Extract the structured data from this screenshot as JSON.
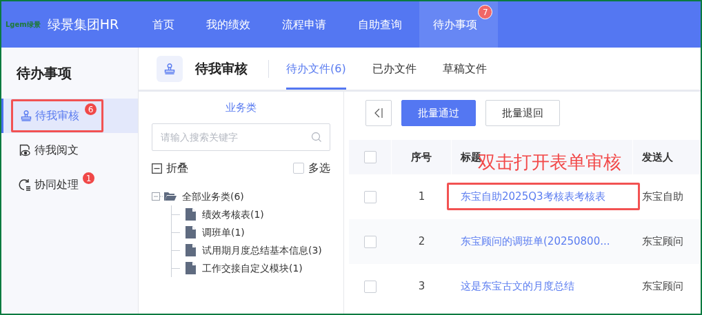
{
  "header": {
    "logo_text": "Lgem绿景",
    "title": "绿景集团HR",
    "nav": [
      {
        "label": "首页",
        "selected": false
      },
      {
        "label": "我的绩效",
        "selected": false
      },
      {
        "label": "流程申请",
        "selected": false
      },
      {
        "label": "自助查询",
        "selected": false
      },
      {
        "label": "待办事项",
        "selected": true,
        "badge": "7"
      }
    ]
  },
  "sidebar": {
    "title": "待办事项",
    "items": [
      {
        "label": "待我审核",
        "kind": "stamp",
        "selected": true,
        "badge": "6",
        "highlighted": true
      },
      {
        "label": "待我阅文",
        "kind": "doc-eye",
        "selected": false,
        "highlighted": false
      },
      {
        "label": "协同处理",
        "kind": "cycle",
        "selected": false,
        "badge": "1",
        "highlighted": false
      }
    ]
  },
  "page_header": {
    "title": "待我审核",
    "tabs": [
      {
        "label": "待办文件(6)",
        "selected": true
      },
      {
        "label": "已办文件",
        "selected": false
      },
      {
        "label": "草稿文件",
        "selected": false
      }
    ]
  },
  "category_panel": {
    "title": "业务类",
    "search": {
      "placeholder": "请输入搜索关键字"
    },
    "collapse_label": "折叠",
    "multi_select": {
      "label": "多选",
      "checked": false
    },
    "tree": [
      {
        "label": "全部业务类(6)",
        "expanded": true,
        "children": [
          {
            "label": "绩效考核表(1)"
          },
          {
            "label": "调班单(1)"
          },
          {
            "label": "试用期月度总结基本信息(3)"
          },
          {
            "label": "工作交接自定义模块(1)"
          }
        ]
      }
    ]
  },
  "toolbar": {
    "buttons": [
      {
        "label": "批量通过",
        "kind": "primary"
      },
      {
        "label": "批量退回",
        "kind": "default"
      }
    ]
  },
  "table": {
    "header_checked": false,
    "columns": [
      "序号",
      "标题",
      "发送人"
    ],
    "rows": [
      {
        "checked": false,
        "number": "1",
        "title": "东宝自助2025Q3考核表考核表",
        "sender": "东宝自助",
        "highlighted": true
      },
      {
        "checked": false,
        "number": "2",
        "title": "东宝顾问的调班单(20250800...",
        "sender": "东宝顾问",
        "highlighted": false
      },
      {
        "checked": false,
        "number": "3",
        "title": "这是东宝古文的月度总结",
        "sender": "东宝顾问",
        "highlighted": false
      }
    ]
  },
  "annotation": {
    "text": "双击打开表单审核"
  }
}
